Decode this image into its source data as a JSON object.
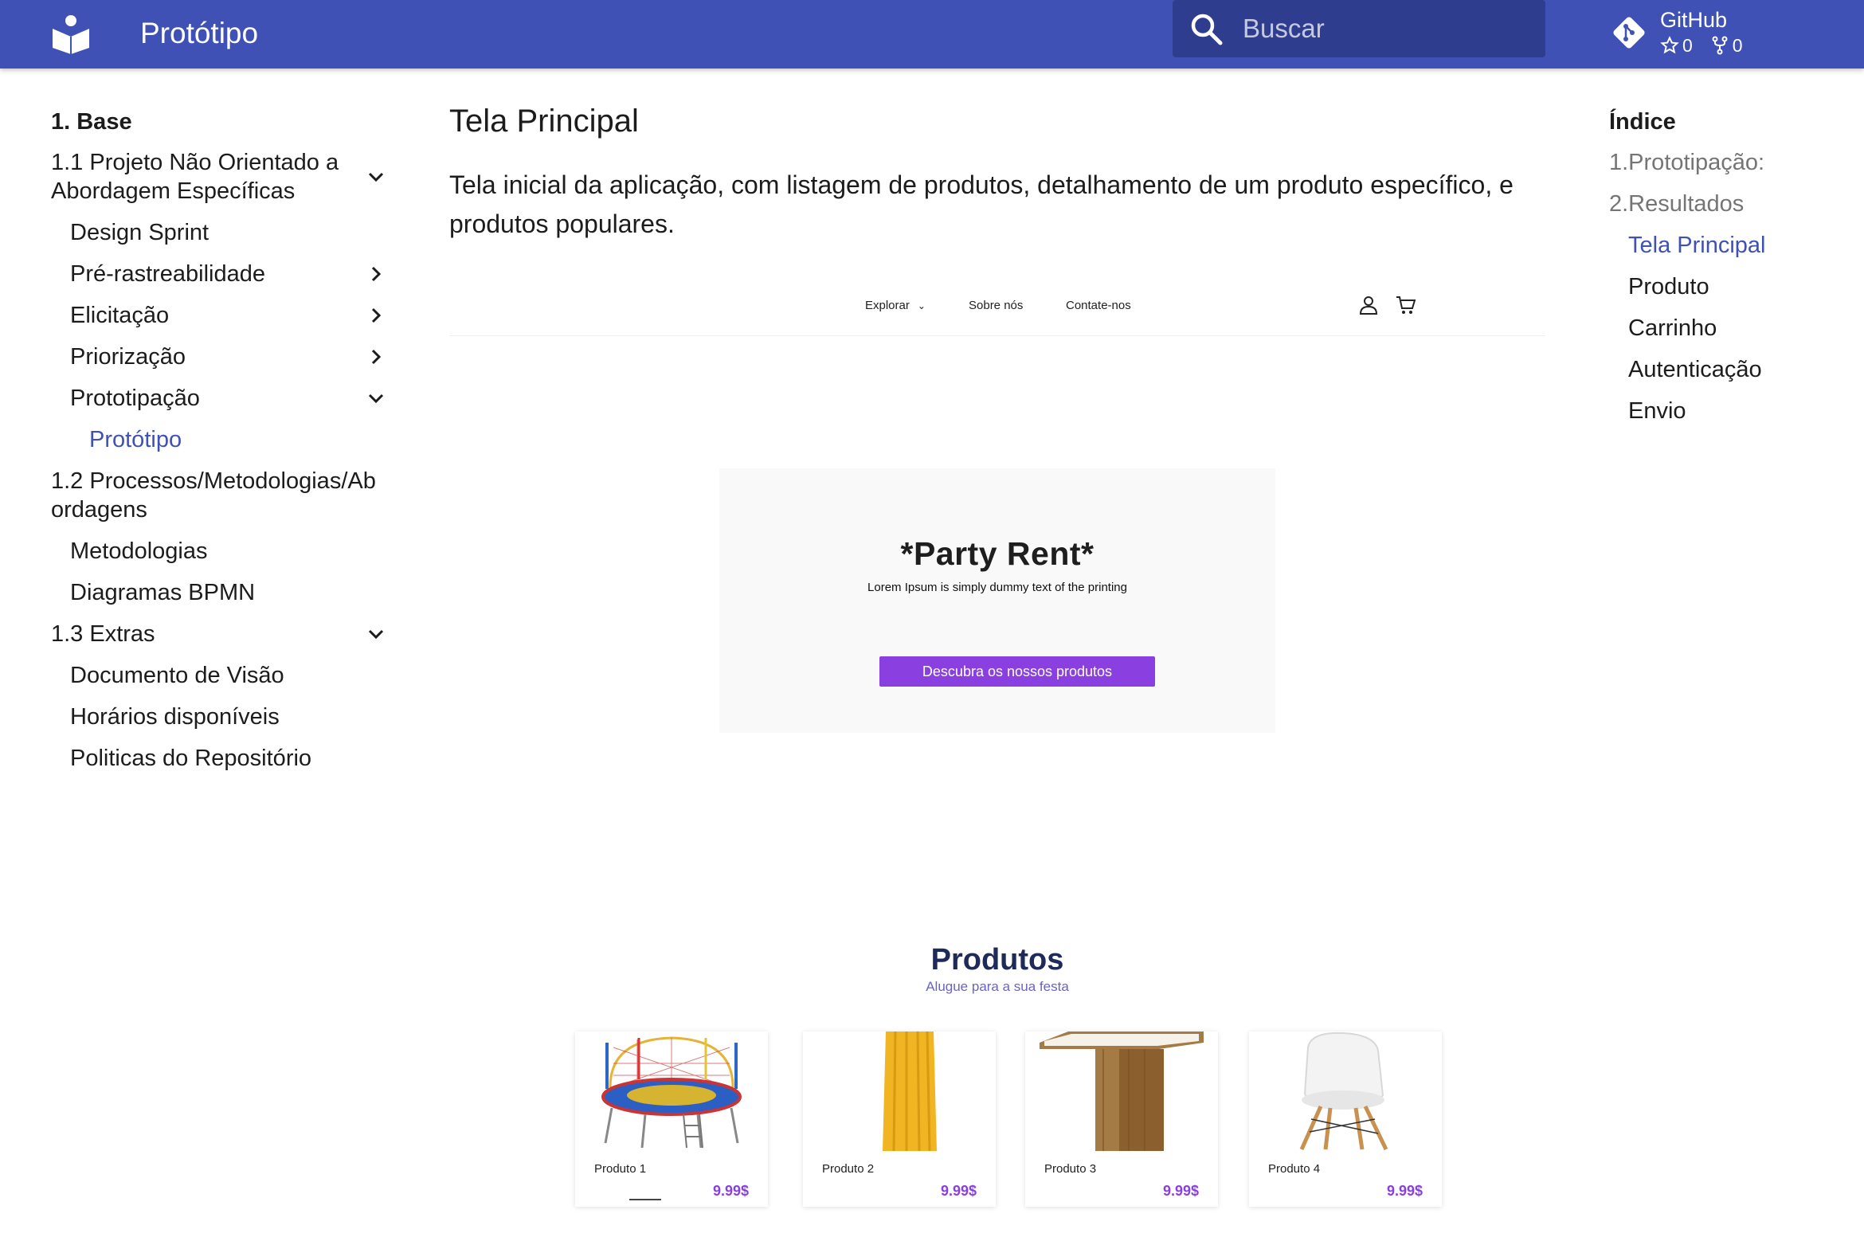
{
  "header": {
    "site_title": "Protótipo",
    "search_placeholder": "Buscar",
    "repo_name": "GitHub",
    "stars": "0",
    "forks": "0",
    "color": "#4051b5"
  },
  "nav": {
    "section_title": "1. Base",
    "items": [
      {
        "label": "1.1 Projeto Não Orientado a Abordagem Específicas"
      },
      {
        "label": "Design Sprint"
      },
      {
        "label": "Pré-rastreabilidade"
      },
      {
        "label": "Elicitação"
      },
      {
        "label": "Priorização"
      },
      {
        "label": "Prototipação"
      },
      {
        "label": "Protótipo"
      },
      {
        "label": "1.2 Processos/Metodologias/Abordagens"
      },
      {
        "label": "Metodologias"
      },
      {
        "label": "Diagramas BPMN"
      },
      {
        "label": "1.3 Extras"
      },
      {
        "label": "Documento de Visão"
      },
      {
        "label": "Horários disponíveis"
      },
      {
        "label": "Politicas do Repositório"
      }
    ]
  },
  "main": {
    "title": "Tela Principal",
    "description": "Tela inicial da aplicação, com listagem de produtos, detalhamento de um produto específico, e produtos populares."
  },
  "mockup": {
    "nav": {
      "explore": "Explorar",
      "about": "Sobre nós",
      "contact": "Contate-nos"
    },
    "hero": {
      "title": "*Party Rent*",
      "subtitle": "Lorem Ipsum is simply dummy text of the printing",
      "button": "Descubra os nossos produtos"
    },
    "products": {
      "title": "Produtos",
      "subtitle": "Alugue para a sua festa",
      "items": [
        {
          "name": "Produto 1",
          "price": "9.99$",
          "icon": "trampoline-image"
        },
        {
          "name": "Produto 2",
          "price": "9.99$",
          "icon": "tablecloth-image"
        },
        {
          "name": "Produto 3",
          "price": "9.99$",
          "icon": "table-image"
        },
        {
          "name": "Produto 4",
          "price": "9.99$",
          "icon": "chair-image"
        }
      ]
    },
    "accent_color": "#8a3fe0"
  },
  "toc": {
    "title": "Índice",
    "items": [
      {
        "label": "1.Prototipação:"
      },
      {
        "label": "2.Resultados"
      },
      {
        "label": "Tela Principal"
      },
      {
        "label": "Produto"
      },
      {
        "label": "Carrinho"
      },
      {
        "label": "Autenticação"
      },
      {
        "label": "Envio"
      }
    ]
  }
}
